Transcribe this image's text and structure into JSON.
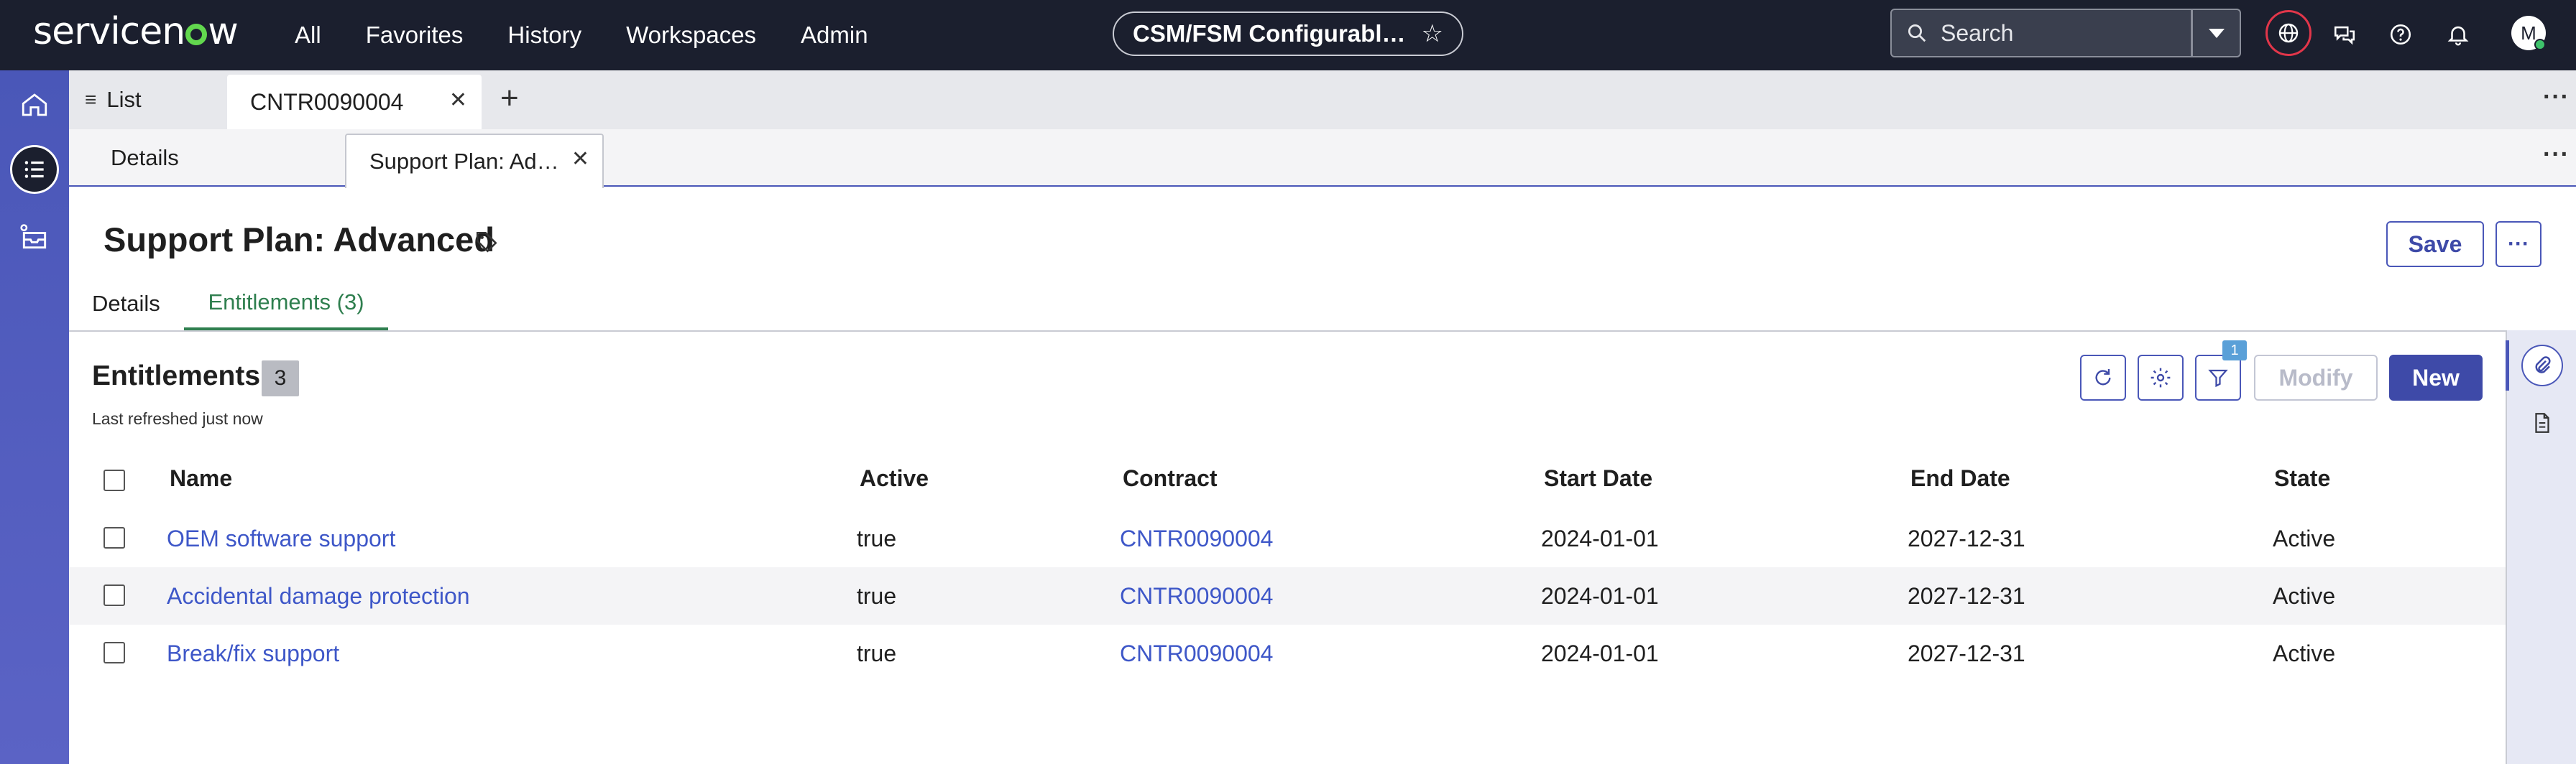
{
  "header": {
    "logo_text": "servicenow",
    "nav": [
      "All",
      "Favorites",
      "History",
      "Workspaces",
      "Admin"
    ],
    "app_pill": "CSM/FSM Configurabl…",
    "search_placeholder": "Search",
    "avatar_initial": "M",
    "icons": [
      "globe-icon",
      "chat-icon",
      "help-icon",
      "bell-icon"
    ]
  },
  "rail": {
    "items": [
      "home-icon",
      "list-icon",
      "inbox-icon"
    ]
  },
  "tabs_primary": {
    "list_label": "List",
    "record_tab": "CNTR0090004",
    "more": "···"
  },
  "tabs_secondary": {
    "details": "Details",
    "active_tab": "Support Plan: Ad…",
    "more": "···"
  },
  "record": {
    "title": "Support Plan: Advanced",
    "save_label": "Save",
    "more_label": "···",
    "form_tabs": {
      "details": "Details",
      "entitlements": "Entitlements (3)"
    }
  },
  "list": {
    "title": "Entitlements",
    "count": "3",
    "refreshed": "Last refreshed just now",
    "filter_count": "1",
    "modify_label": "Modify",
    "new_label": "New",
    "columns": [
      "Name",
      "Active",
      "Contract",
      "Start Date",
      "End Date",
      "State"
    ],
    "rows": [
      {
        "name": "OEM software support",
        "active": "true",
        "contract": "CNTR0090004",
        "start": "2024-01-01",
        "end": "2027-12-31",
        "state": "Active"
      },
      {
        "name": "Accidental damage protection",
        "active": "true",
        "contract": "CNTR0090004",
        "start": "2024-01-01",
        "end": "2027-12-31",
        "state": "Active"
      },
      {
        "name": "Break/fix support",
        "active": "true",
        "contract": "CNTR0090004",
        "start": "2024-01-01",
        "end": "2027-12-31",
        "state": "Active"
      }
    ]
  },
  "colors": {
    "header_bg": "#1b1f2e",
    "rail_bg": "#4a57b8",
    "primary": "#3e4aa8",
    "link": "#3e57c8",
    "active_tab": "#2f7f4f",
    "alert_ring": "#e2364a"
  }
}
